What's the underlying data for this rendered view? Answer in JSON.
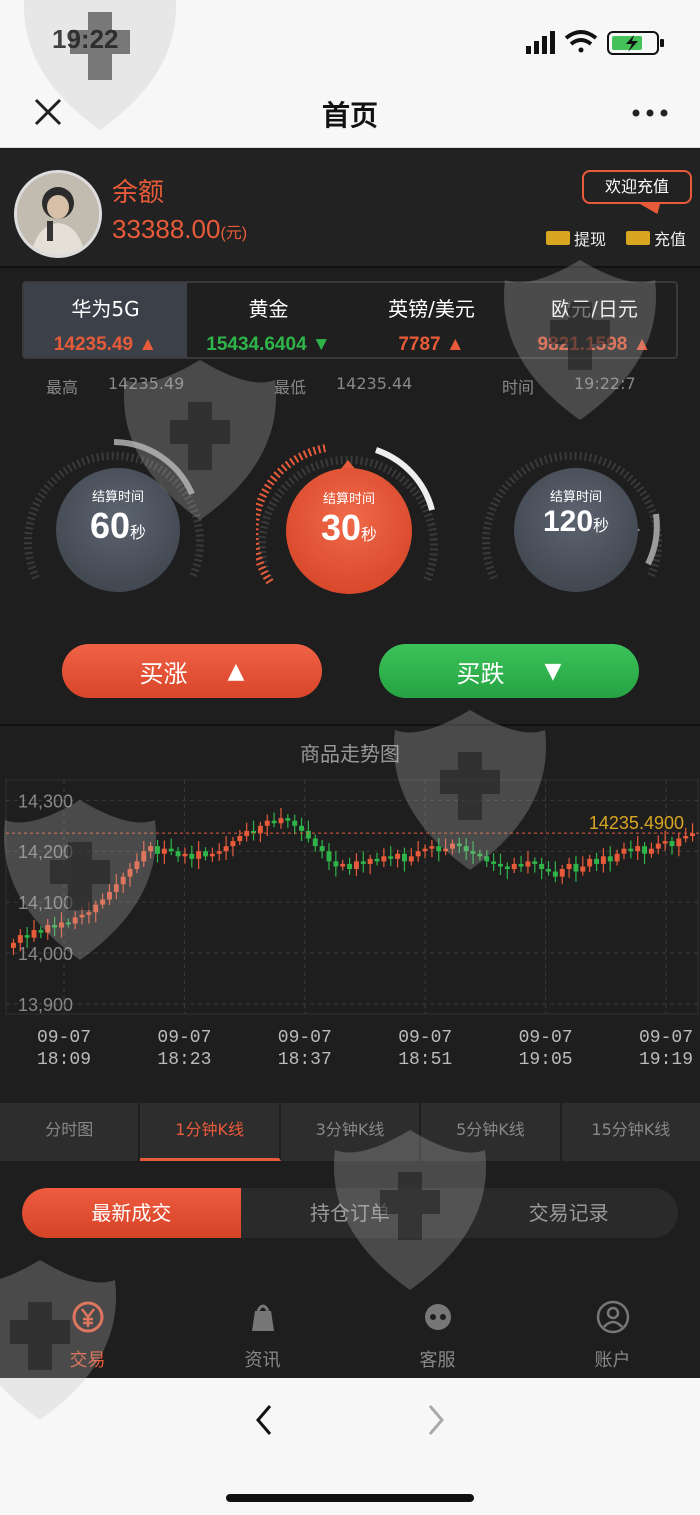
{
  "status": {
    "time": "19:22"
  },
  "nav": {
    "title": "首页"
  },
  "user": {
    "balance_label": "余额",
    "balance": "33388.00",
    "balance_unit": "(元)",
    "welcome": "欢迎充值",
    "withdraw": "提现",
    "recharge": "充值"
  },
  "assets": [
    {
      "name": "华为5G",
      "price": "14235.49",
      "dir": "up"
    },
    {
      "name": "黄金",
      "price": "15434.6404",
      "dir": "down"
    },
    {
      "name": "英镑/美元",
      "price": "7787",
      "dir": "up"
    },
    {
      "name": "欧元/日元",
      "price": "9821.1598",
      "dir": "up"
    }
  ],
  "stats": {
    "high_label": "最高",
    "high": "14235.49",
    "low_label": "最低",
    "low": "14235.44",
    "time_label": "时间",
    "time": "19:22:7"
  },
  "dials": [
    {
      "caption": "结算时间",
      "value": "60",
      "unit": "秒",
      "active": false
    },
    {
      "caption": "结算时间",
      "value": "30",
      "unit": "秒",
      "active": true
    },
    {
      "caption": "结算时间",
      "value": "120",
      "unit": "秒",
      "active": false
    }
  ],
  "buttons": {
    "buy_up": "买涨",
    "buy_down": "买跌"
  },
  "chart_title": "商品走势图",
  "chart_data": {
    "type": "candlestick",
    "current_price_label": "14235.4900",
    "current_price": 14235.49,
    "ylim": [
      13880,
      14340
    ],
    "y_ticks": [
      13900,
      14000,
      14100,
      14200,
      14300
    ],
    "y_tick_labels": [
      "13,900",
      "14,000",
      "14,100",
      "14,200",
      "14,300"
    ],
    "x_ticks": [
      {
        "date": "09-07",
        "time": "18:09"
      },
      {
        "date": "09-07",
        "time": "18:23"
      },
      {
        "date": "09-07",
        "time": "18:37"
      },
      {
        "date": "09-07",
        "time": "18:51"
      },
      {
        "date": "09-07",
        "time": "19:05"
      },
      {
        "date": "09-07",
        "time": "19:19"
      }
    ],
    "close": [
      14020,
      14035,
      14030,
      14045,
      14040,
      14055,
      14050,
      14060,
      14058,
      14070,
      14075,
      14080,
      14095,
      14105,
      14120,
      14135,
      14150,
      14165,
      14180,
      14200,
      14210,
      14195,
      14205,
      14200,
      14190,
      14195,
      14185,
      14200,
      14190,
      14195,
      14200,
      14210,
      14220,
      14230,
      14240,
      14235,
      14250,
      14260,
      14255,
      14265,
      14260,
      14250,
      14240,
      14225,
      14210,
      14200,
      14180,
      14170,
      14175,
      14165,
      14180,
      14175,
      14185,
      14180,
      14190,
      14185,
      14195,
      14180,
      14190,
      14200,
      14205,
      14210,
      14200,
      14205,
      14215,
      14210,
      14200,
      14195,
      14190,
      14180,
      14175,
      14170,
      14165,
      14175,
      14170,
      14180,
      14175,
      14165,
      14160,
      14150,
      14165,
      14175,
      14160,
      14170,
      14185,
      14175,
      14190,
      14180,
      14195,
      14205,
      14200,
      14210,
      14195,
      14205,
      14215,
      14220,
      14210,
      14225,
      14230,
      14235
    ]
  },
  "periods": [
    {
      "label": "分时图",
      "selected": false
    },
    {
      "label": "1分钟K线",
      "selected": true
    },
    {
      "label": "3分钟K线",
      "selected": false
    },
    {
      "label": "5分钟K线",
      "selected": false
    },
    {
      "label": "15分钟K线",
      "selected": false
    }
  ],
  "trade_tabs": [
    {
      "label": "最新成交",
      "selected": true
    },
    {
      "label": "持仓订单",
      "selected": false
    },
    {
      "label": "交易记录",
      "selected": false
    }
  ],
  "bottom_nav": [
    {
      "label": "交易",
      "icon": "yuan-coin-icon",
      "selected": true
    },
    {
      "label": "资讯",
      "icon": "news-bag-icon",
      "selected": false
    },
    {
      "label": "客服",
      "icon": "service-icon",
      "selected": false
    },
    {
      "label": "账户",
      "icon": "user-icon",
      "selected": false
    }
  ],
  "colors": {
    "up": "#e85b3a",
    "down": "#2fb44a",
    "gold": "#d9a622"
  }
}
